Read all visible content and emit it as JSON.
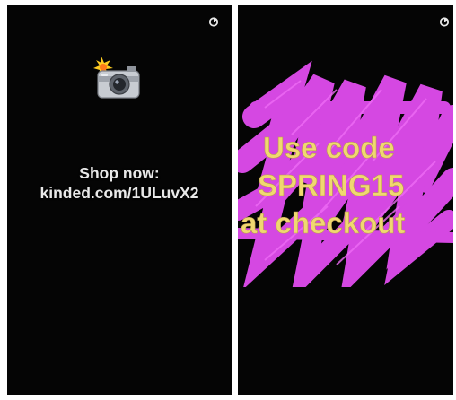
{
  "left_panel": {
    "line1": "Shop now:",
    "line2": "kinded.com/1ULuvX2",
    "icon": "camera-flash-emoji",
    "timer_icon": "snap-timer-icon"
  },
  "right_panel": {
    "line1": "Use code",
    "line2": "SPRING15",
    "line3": "at checkout",
    "timer_icon": "snap-timer-icon",
    "scribble_color": "#d548e2",
    "text_color": "#f0d870"
  }
}
